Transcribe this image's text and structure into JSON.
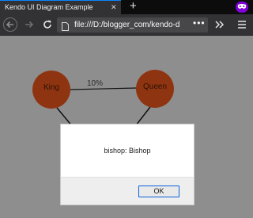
{
  "browser": {
    "tab_title": "Kendo UI Diagram Example",
    "tab_close": "✕",
    "new_tab": "+",
    "url": "file:///D:/blogger_com/kendo-diagram",
    "url_more": "•••",
    "icons": {
      "back": "back-arrow-icon",
      "forward": "forward-arrow-icon",
      "reload": "reload-icon",
      "page": "page-icon",
      "overflow": "chevron-double-right-icon",
      "menu": "hamburger-menu-icon",
      "private": "private-mask-icon"
    },
    "accent": "#0a84ff",
    "private_color": "#8000d7"
  },
  "diagram": {
    "nodes": [
      {
        "label": "King"
      },
      {
        "label": "Queen"
      }
    ],
    "edge_label": "10%",
    "node_color": "#8f3410"
  },
  "alert": {
    "message": "bishop: Bishop",
    "ok_label": "OK"
  }
}
